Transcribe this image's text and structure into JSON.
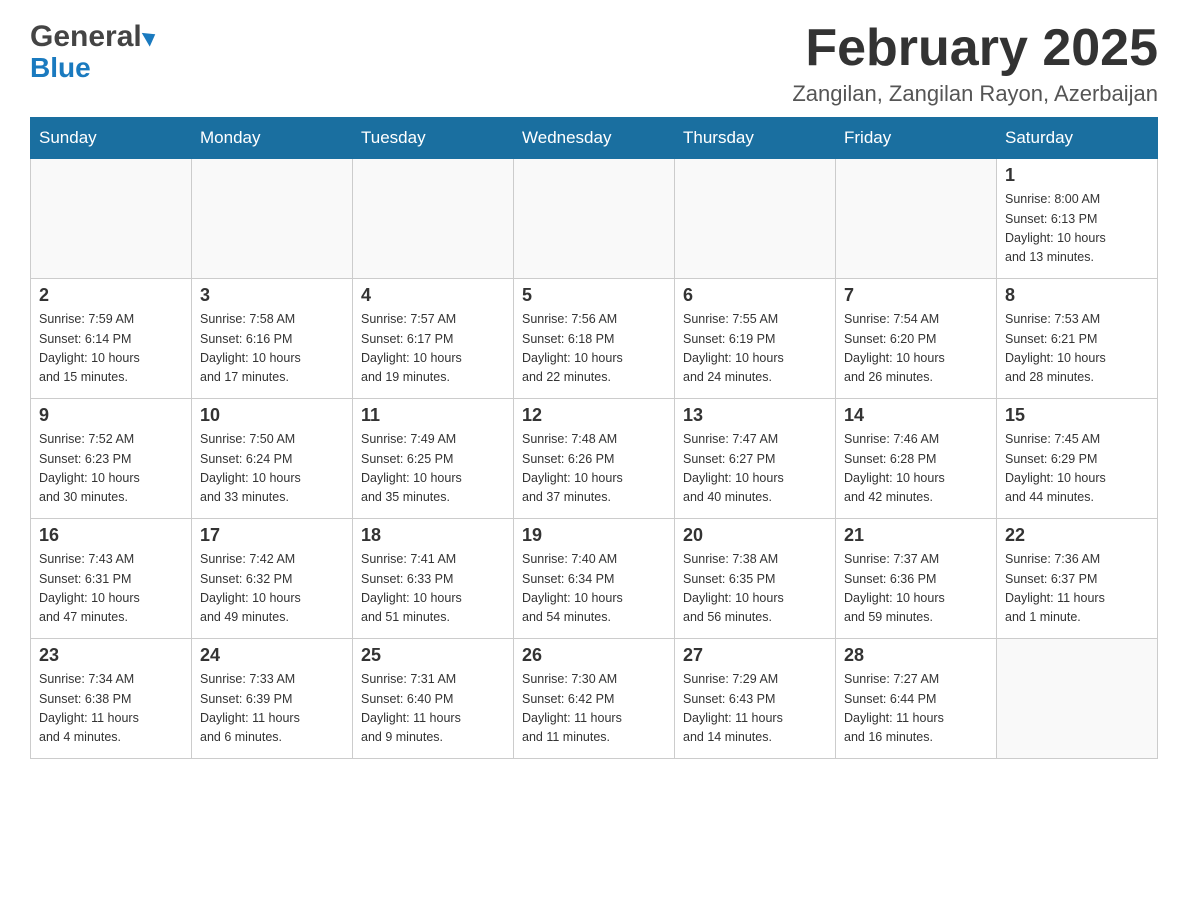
{
  "header": {
    "logo_general": "General",
    "logo_blue": "Blue",
    "month_title": "February 2025",
    "location": "Zangilan, Zangilan Rayon, Azerbaijan"
  },
  "weekdays": [
    "Sunday",
    "Monday",
    "Tuesday",
    "Wednesday",
    "Thursday",
    "Friday",
    "Saturday"
  ],
  "weeks": [
    [
      {
        "day": "",
        "info": ""
      },
      {
        "day": "",
        "info": ""
      },
      {
        "day": "",
        "info": ""
      },
      {
        "day": "",
        "info": ""
      },
      {
        "day": "",
        "info": ""
      },
      {
        "day": "",
        "info": ""
      },
      {
        "day": "1",
        "info": "Sunrise: 8:00 AM\nSunset: 6:13 PM\nDaylight: 10 hours\nand 13 minutes."
      }
    ],
    [
      {
        "day": "2",
        "info": "Sunrise: 7:59 AM\nSunset: 6:14 PM\nDaylight: 10 hours\nand 15 minutes."
      },
      {
        "day": "3",
        "info": "Sunrise: 7:58 AM\nSunset: 6:16 PM\nDaylight: 10 hours\nand 17 minutes."
      },
      {
        "day": "4",
        "info": "Sunrise: 7:57 AM\nSunset: 6:17 PM\nDaylight: 10 hours\nand 19 minutes."
      },
      {
        "day": "5",
        "info": "Sunrise: 7:56 AM\nSunset: 6:18 PM\nDaylight: 10 hours\nand 22 minutes."
      },
      {
        "day": "6",
        "info": "Sunrise: 7:55 AM\nSunset: 6:19 PM\nDaylight: 10 hours\nand 24 minutes."
      },
      {
        "day": "7",
        "info": "Sunrise: 7:54 AM\nSunset: 6:20 PM\nDaylight: 10 hours\nand 26 minutes."
      },
      {
        "day": "8",
        "info": "Sunrise: 7:53 AM\nSunset: 6:21 PM\nDaylight: 10 hours\nand 28 minutes."
      }
    ],
    [
      {
        "day": "9",
        "info": "Sunrise: 7:52 AM\nSunset: 6:23 PM\nDaylight: 10 hours\nand 30 minutes."
      },
      {
        "day": "10",
        "info": "Sunrise: 7:50 AM\nSunset: 6:24 PM\nDaylight: 10 hours\nand 33 minutes."
      },
      {
        "day": "11",
        "info": "Sunrise: 7:49 AM\nSunset: 6:25 PM\nDaylight: 10 hours\nand 35 minutes."
      },
      {
        "day": "12",
        "info": "Sunrise: 7:48 AM\nSunset: 6:26 PM\nDaylight: 10 hours\nand 37 minutes."
      },
      {
        "day": "13",
        "info": "Sunrise: 7:47 AM\nSunset: 6:27 PM\nDaylight: 10 hours\nand 40 minutes."
      },
      {
        "day": "14",
        "info": "Sunrise: 7:46 AM\nSunset: 6:28 PM\nDaylight: 10 hours\nand 42 minutes."
      },
      {
        "day": "15",
        "info": "Sunrise: 7:45 AM\nSunset: 6:29 PM\nDaylight: 10 hours\nand 44 minutes."
      }
    ],
    [
      {
        "day": "16",
        "info": "Sunrise: 7:43 AM\nSunset: 6:31 PM\nDaylight: 10 hours\nand 47 minutes."
      },
      {
        "day": "17",
        "info": "Sunrise: 7:42 AM\nSunset: 6:32 PM\nDaylight: 10 hours\nand 49 minutes."
      },
      {
        "day": "18",
        "info": "Sunrise: 7:41 AM\nSunset: 6:33 PM\nDaylight: 10 hours\nand 51 minutes."
      },
      {
        "day": "19",
        "info": "Sunrise: 7:40 AM\nSunset: 6:34 PM\nDaylight: 10 hours\nand 54 minutes."
      },
      {
        "day": "20",
        "info": "Sunrise: 7:38 AM\nSunset: 6:35 PM\nDaylight: 10 hours\nand 56 minutes."
      },
      {
        "day": "21",
        "info": "Sunrise: 7:37 AM\nSunset: 6:36 PM\nDaylight: 10 hours\nand 59 minutes."
      },
      {
        "day": "22",
        "info": "Sunrise: 7:36 AM\nSunset: 6:37 PM\nDaylight: 11 hours\nand 1 minute."
      }
    ],
    [
      {
        "day": "23",
        "info": "Sunrise: 7:34 AM\nSunset: 6:38 PM\nDaylight: 11 hours\nand 4 minutes."
      },
      {
        "day": "24",
        "info": "Sunrise: 7:33 AM\nSunset: 6:39 PM\nDaylight: 11 hours\nand 6 minutes."
      },
      {
        "day": "25",
        "info": "Sunrise: 7:31 AM\nSunset: 6:40 PM\nDaylight: 11 hours\nand 9 minutes."
      },
      {
        "day": "26",
        "info": "Sunrise: 7:30 AM\nSunset: 6:42 PM\nDaylight: 11 hours\nand 11 minutes."
      },
      {
        "day": "27",
        "info": "Sunrise: 7:29 AM\nSunset: 6:43 PM\nDaylight: 11 hours\nand 14 minutes."
      },
      {
        "day": "28",
        "info": "Sunrise: 7:27 AM\nSunset: 6:44 PM\nDaylight: 11 hours\nand 16 minutes."
      },
      {
        "day": "",
        "info": ""
      }
    ]
  ]
}
